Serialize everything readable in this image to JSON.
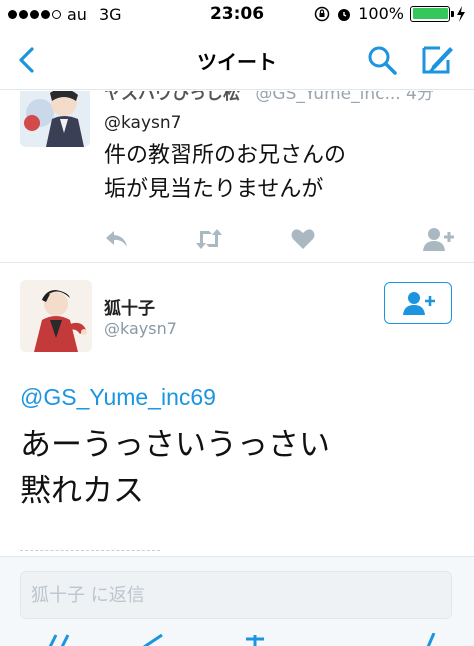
{
  "status_bar": {
    "carrier": "au",
    "network": "3G",
    "time": "23:06",
    "battery_percent": "100%",
    "battery_level": 1.0,
    "signal_bars": 4
  },
  "nav": {
    "title": "ツイート",
    "accent_color": "#1b95e0"
  },
  "previous_tweet": {
    "name_partial": "ヤスハウひっじ松",
    "handle_partial": "@GS_Yume_inc... 4分",
    "handle": "@kaysn7",
    "text_line1": "件の教習所のお兄さんの",
    "text_line2": "垢が見当たりませんが"
  },
  "main_tweet": {
    "name": "狐十子",
    "handle": "@kaysn7",
    "reply_to": "@GS_Yume_inc69",
    "text_line1": "あーうっさいうっさい",
    "text_line2": "黙れカス"
  },
  "reply": {
    "placeholder": "狐十子 に返信"
  },
  "icons": [
    "back-icon",
    "search-icon",
    "compose-icon",
    "reply-icon",
    "retweet-icon",
    "like-icon",
    "follow-icon"
  ]
}
